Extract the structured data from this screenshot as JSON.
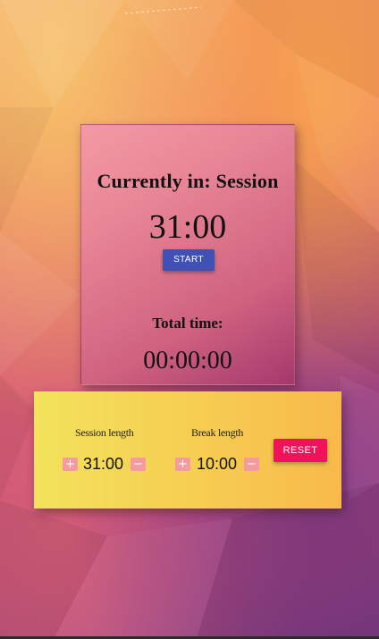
{
  "timer": {
    "status_text": "Currently in: Session",
    "clock": "31:00",
    "start_label": "START",
    "total_label": "Total time:",
    "total_value": "00:00:00"
  },
  "settings": {
    "session": {
      "label": "Session length",
      "value": "31:00",
      "increment_icon": "plus-icon",
      "decrement_icon": "minus-icon"
    },
    "break": {
      "label": "Break length",
      "value": "10:00",
      "increment_icon": "plus-icon",
      "decrement_icon": "minus-icon"
    },
    "reset_label": "RESET"
  },
  "colors": {
    "start_button": "#3f51b5",
    "reset_button": "#f0125b",
    "stepper_button": "#f59aa0",
    "timer_card": "#e88596",
    "settings_panel": "#f6cf52"
  }
}
